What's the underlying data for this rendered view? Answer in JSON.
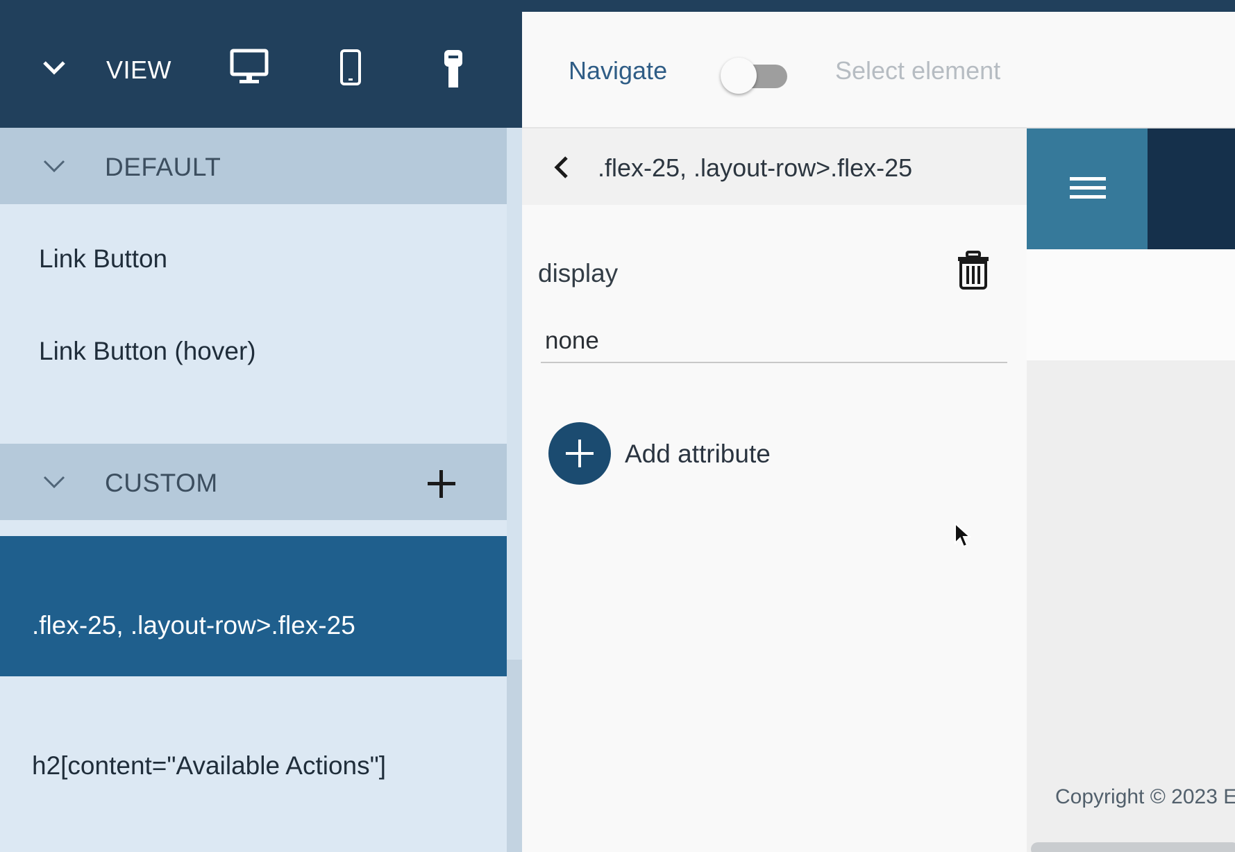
{
  "view_bar": {
    "label": "VIEW",
    "icons": [
      "chevron-down-icon",
      "desktop-icon",
      "mobile-icon",
      "key-icon"
    ]
  },
  "sidebar": {
    "default_section": {
      "label": "DEFAULT",
      "items": [
        {
          "label": "Link Button"
        },
        {
          "label": "Link Button (hover)"
        }
      ]
    },
    "custom_section": {
      "label": "CUSTOM",
      "items": [
        {
          "label": ".flex-25, .layout-row>.flex-25",
          "selected": true
        },
        {
          "label": "h2[content=\"Available Actions\"]",
          "selected": false
        }
      ]
    }
  },
  "toolbar": {
    "navigate_label": "Navigate",
    "toggle_on": false,
    "select_element_label": "Select element"
  },
  "editor": {
    "selector": ".flex-25, .layout-row>.flex-25",
    "attribute": {
      "name": "display",
      "value": "none"
    },
    "add_attribute_label": "Add attribute"
  },
  "preview": {
    "copyright": "Copyright © 2023 E"
  },
  "colors": {
    "nav_dark": "#21405c",
    "selected_item": "#1f5f8d",
    "accent_button": "#1b4b70",
    "preview_menu": "#36799a",
    "section_header": "#b5c9da"
  }
}
